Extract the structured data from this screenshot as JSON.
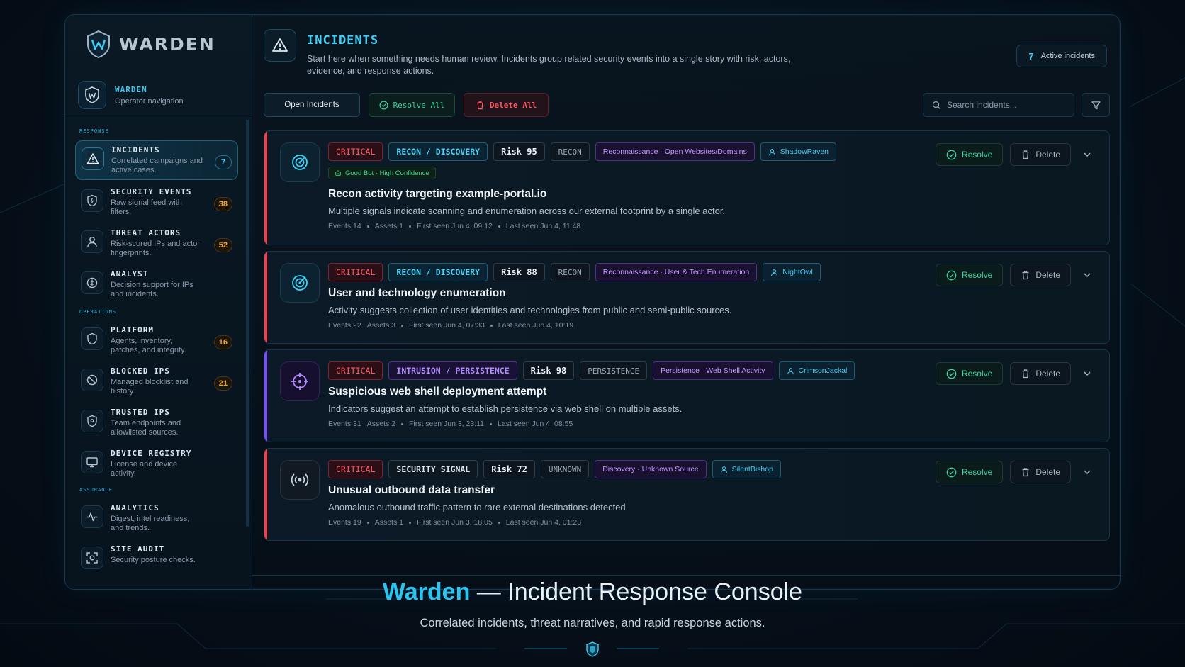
{
  "brand": {
    "name": "WARDEN"
  },
  "operator": {
    "title": "WARDEN",
    "subtitle": "Operator navigation"
  },
  "sidebar": {
    "sections": [
      {
        "label": "RESPONSE"
      },
      {
        "label": "OPERATIONS"
      },
      {
        "label": "ASSURANCE"
      }
    ],
    "items": [
      {
        "title": "INCIDENTS",
        "desc": "Correlated campaigns and active cases.",
        "badge": "7",
        "icon": "warning-triangle-icon"
      },
      {
        "title": "SECURITY EVENTS",
        "desc": "Raw signal feed with filters.",
        "badge": "38",
        "icon": "shield-bolt-icon"
      },
      {
        "title": "THREAT ACTORS",
        "desc": "Risk-scored IPs and actor fingerprints.",
        "badge": "52",
        "icon": "user-icon"
      },
      {
        "title": "ANALYST",
        "desc": "Decision support for IPs and incidents.",
        "badge": "",
        "icon": "compass-icon"
      },
      {
        "title": "PLATFORM",
        "desc": "Agents, inventory, patches, and integrity.",
        "badge": "16",
        "icon": "shield-icon"
      },
      {
        "title": "BLOCKED IPS",
        "desc": "Managed blocklist and history.",
        "badge": "21",
        "icon": "block-icon"
      },
      {
        "title": "TRUSTED IPS",
        "desc": "Team endpoints and allowlisted sources.",
        "badge": "",
        "icon": "shield-check-icon"
      },
      {
        "title": "DEVICE REGISTRY",
        "desc": "License and device activity.",
        "badge": "",
        "icon": "monitor-icon"
      },
      {
        "title": "ANALYTICS",
        "desc": "Digest, intel readiness, and trends.",
        "badge": "",
        "icon": "pulse-icon"
      },
      {
        "title": "SITE AUDIT",
        "desc": "Security posture checks.",
        "badge": "",
        "icon": "scan-icon"
      }
    ]
  },
  "header": {
    "title": "INCIDENTS",
    "description": "Start here when something needs human review. Incidents group related security events into a single story with risk, actors, evidence, and response actions.",
    "active_count": "7",
    "active_label": "Active incidents"
  },
  "toolbar": {
    "open_label": "Open Incidents",
    "resolve_all_label": "Resolve All",
    "delete_all_label": "Delete All",
    "search_placeholder": "Search incidents..."
  },
  "incidents": [
    {
      "severity": "CRITICAL",
      "category": "RECON / DISCOVERY",
      "risk": "Risk 95",
      "phase": "RECON",
      "technique": "Reconnaissance · Open Websites/Domains",
      "actor": "ShadowRaven",
      "bot": "Good Bot · High Confidence",
      "title": "Recon activity targeting example-portal.io",
      "description": "Multiple signals indicate scanning and enumeration across our external footprint by a single actor.",
      "events": "Events 14",
      "assets": "Assets 1",
      "first_seen": "First seen Jun 4, 09:12",
      "last_seen": "Last seen Jun 4, 11:48",
      "resolve_label": "Resolve",
      "delete_label": "Delete"
    },
    {
      "severity": "CRITICAL",
      "category": "RECON / DISCOVERY",
      "risk": "Risk 88",
      "phase": "RECON",
      "technique": "Reconnaissance · User & Tech Enumeration",
      "actor": "NightOwl",
      "title": "User and technology enumeration",
      "description": "Activity suggests collection of user identities and technologies from public and semi-public sources.",
      "events": "Events 22",
      "assets": "Assets 3",
      "first_seen": "First seen Jun 4, 07:33",
      "last_seen": "Last seen Jun 4, 10:19",
      "resolve_label": "Resolve",
      "delete_label": "Delete"
    },
    {
      "severity": "CRITICAL",
      "category": "INTRUSION / PERSISTENCE",
      "risk": "Risk 98",
      "phase": "PERSISTENCE",
      "technique": "Persistence · Web Shell Activity",
      "actor": "CrimsonJackal",
      "title": "Suspicious web shell deployment attempt",
      "description": "Indicators suggest an attempt to establish persistence via web shell on multiple assets.",
      "events": "Events 31",
      "assets": "Assets 2",
      "first_seen": "First seen Jun 3, 23:11",
      "last_seen": "Last seen Jun 4, 08:55",
      "resolve_label": "Resolve",
      "delete_label": "Delete"
    },
    {
      "severity": "CRITICAL",
      "category": "SECURITY SIGNAL",
      "risk": "Risk 72",
      "phase": "UNKNOWN",
      "technique": "Discovery · Unknown Source",
      "actor": "SilentBishop",
      "title": "Unusual outbound data transfer",
      "description": "Anomalous outbound traffic pattern to rare external destinations detected.",
      "events": "Events 19",
      "assets": "Assets 1",
      "first_seen": "First seen Jun 3, 18:05",
      "last_seen": "Last seen Jun 4, 01:23",
      "resolve_label": "Resolve",
      "delete_label": "Delete"
    }
  ],
  "caption": {
    "brand": "Warden",
    "title": "— Incident Response Console",
    "subtitle": "Correlated incidents, threat narratives, and rapid response actions."
  },
  "colors": {
    "accent": "#3fd1f5",
    "critical": "#ff5b65",
    "resolve": "#3bd59c",
    "purple": "#7b4cff",
    "amber": "#f0a640"
  }
}
